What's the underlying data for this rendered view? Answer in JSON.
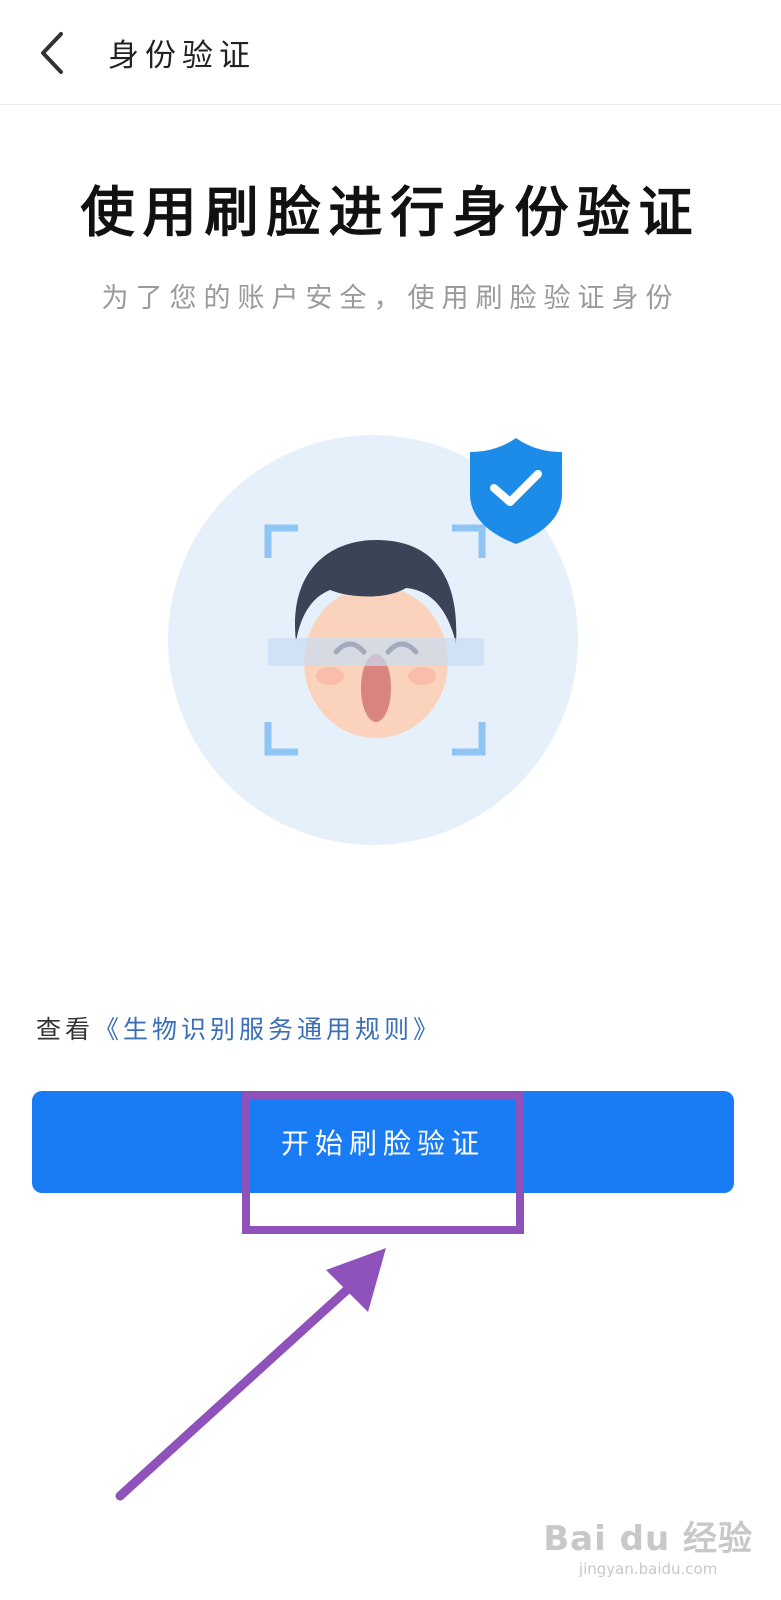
{
  "header": {
    "title": "身份验证",
    "back_icon": "chevron-left-icon"
  },
  "main": {
    "title": "使用刷脸进行身份验证",
    "subtitle": "为了您的账户安全，使用刷脸验证身份"
  },
  "illustration": {
    "icon": "face-scan-illustration",
    "badge_icon": "shield-check-icon",
    "colors": {
      "circle": "#e6f0fb",
      "shield": "#1d8ce8",
      "frame": "#8fc5f5",
      "hair": "#3a4456",
      "skin": "#fbd3bc"
    }
  },
  "rules": {
    "prefix": "查看",
    "link": "《生物识别服务通用规则》"
  },
  "start_button": {
    "label": "开始刷脸验证",
    "color": "#1a7cf5"
  },
  "annotation": {
    "highlight_color": "#8e52ba"
  },
  "watermark": {
    "brand": "Bai du 经验",
    "url": "jingyan.baidu.com"
  }
}
